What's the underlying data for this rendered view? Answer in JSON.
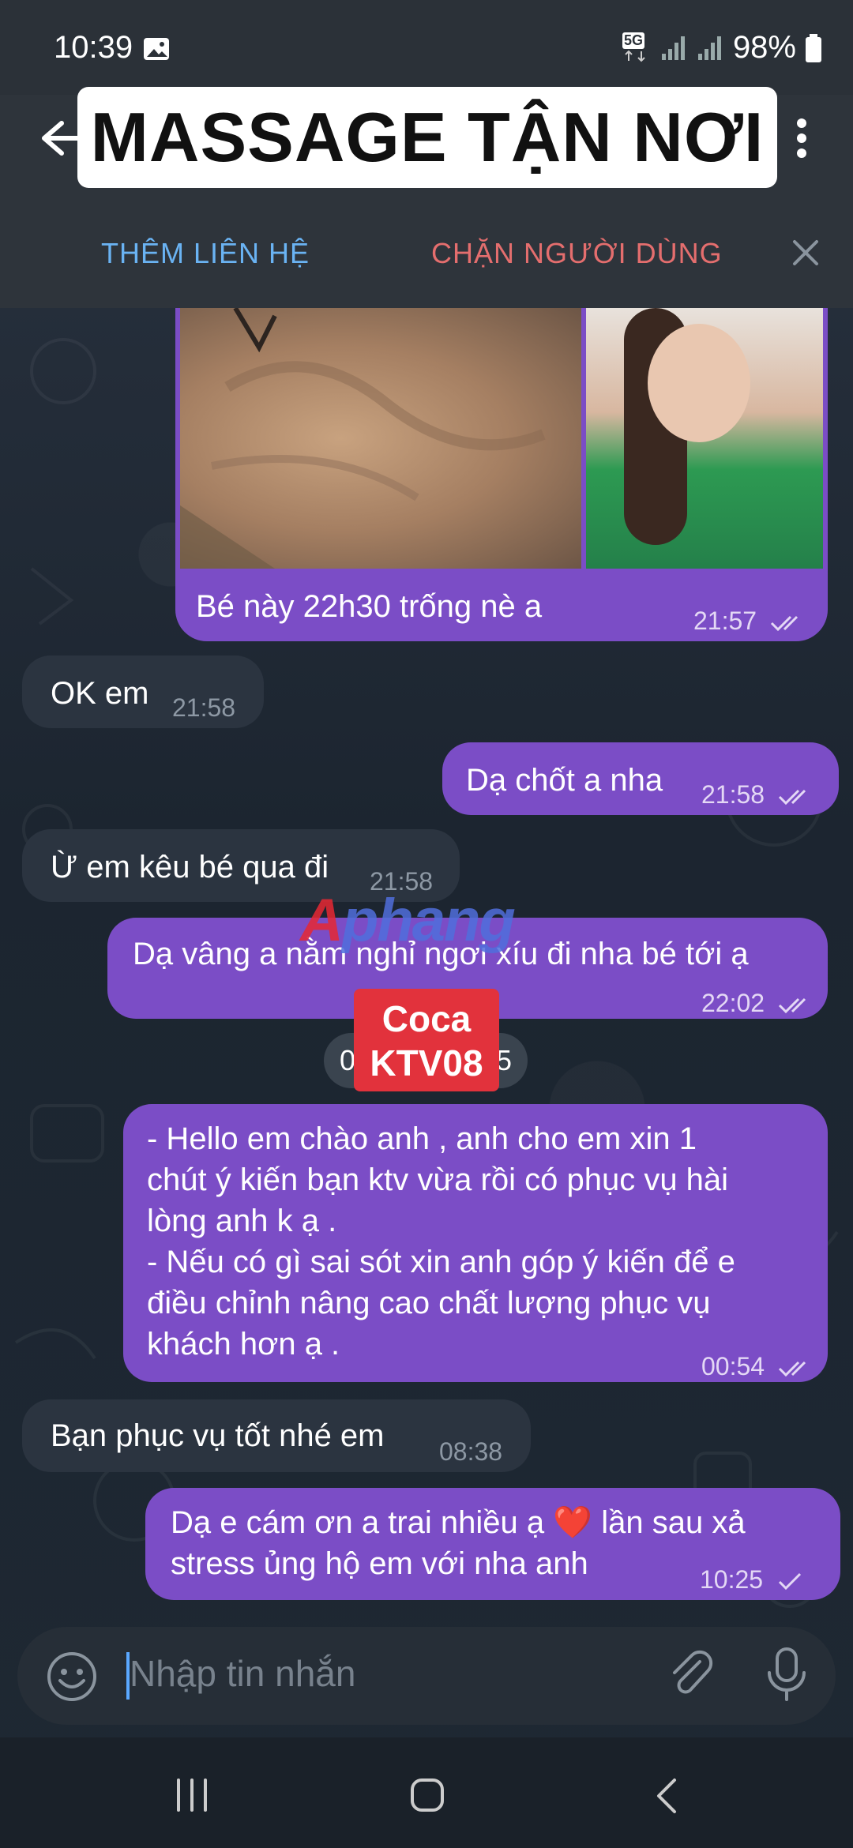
{
  "status_bar": {
    "time": "10:39",
    "network": "5G",
    "battery": "98%"
  },
  "header": {
    "title": "MASSAGE TẬN NƠI",
    "add_contact": "THÊM LIÊN HỆ",
    "block_user": "CHẶN NGƯỜI DÙNG"
  },
  "messages": [
    {
      "dir": "out",
      "text": "Bé này 22h30 trống nè a",
      "time": "21:57",
      "status": "read"
    },
    {
      "dir": "in",
      "text": "OK em",
      "time": "21:58"
    },
    {
      "dir": "out",
      "text": "Dạ chốt a nha",
      "time": "21:58",
      "status": "read"
    },
    {
      "dir": "in",
      "text": "Ừ em kêu bé qua đi",
      "time": "21:58"
    },
    {
      "dir": "out",
      "text": "Dạ vâng a nằm nghỉ ngơi xíu đi nha bé tới ạ",
      "time": "22:02",
      "status": "read"
    },
    {
      "dir": "out",
      "line1": "- Hello em chào anh , anh cho em xin 1",
      "line2": "chút ý kiến bạn ktv vừa rồi có phục vụ hài",
      "line3": "lòng anh k ạ .",
      "line4": "- Nếu có gì sai sót xin anh góp ý kiến để e",
      "line5": "điều chỉnh nâng cao chất lượng phục vụ",
      "line6": "khách hơn ạ .",
      "time": "00:54",
      "status": "read"
    },
    {
      "dir": "in",
      "text": "Bạn phục vụ tốt nhé em",
      "time": "08:38"
    },
    {
      "dir": "out",
      "line1a": "Dạ e cám ơn a trai nhiều ạ",
      "emoji": "❤️",
      "line1b": "lần sau xả",
      "line2": "stress ủng hộ em với nha anh",
      "time": "10:25",
      "status": "sent"
    }
  ],
  "date_pill": {
    "left": "0",
    "right": "5"
  },
  "sticker": {
    "line1": "Coca",
    "line2": "KTV08"
  },
  "watermark": {
    "part1": "A",
    "part2": "phang"
  },
  "input": {
    "placeholder": "Nhập tin nhắn"
  },
  "colors": {
    "outgoing": "#7b4dc6",
    "incoming": "#2b3440",
    "accent": "#6ab3f3",
    "danger": "#e46e6e"
  }
}
